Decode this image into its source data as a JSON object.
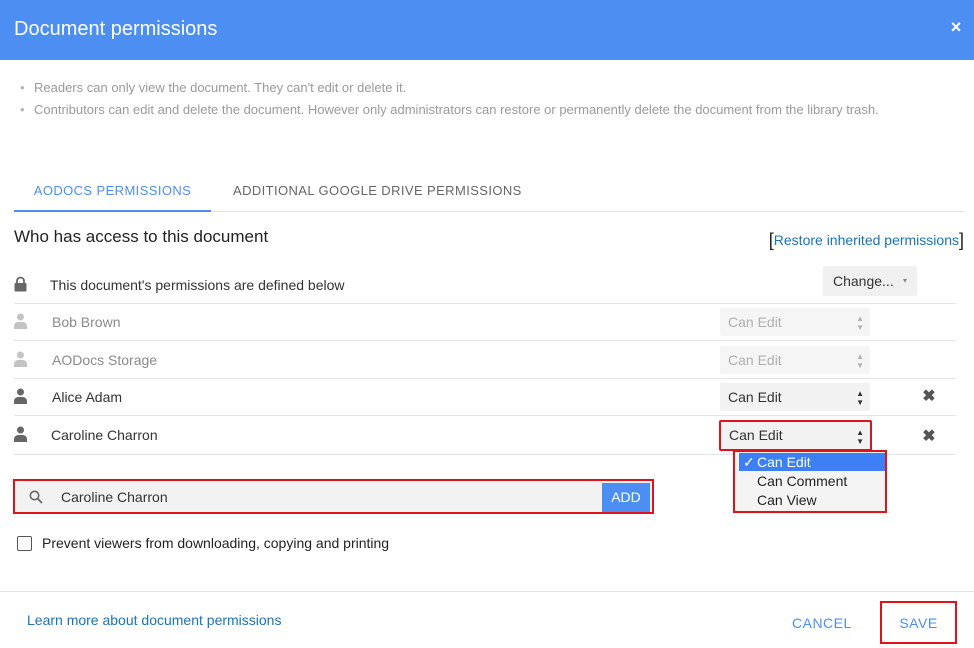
{
  "header": {
    "title": "Document permissions",
    "close_label": "×"
  },
  "info": [
    "Readers can only view the document. They can't edit or delete it.",
    "Contributors can edit and delete the document. However only administrators can restore or permanently delete the document from the library trash."
  ],
  "tabs": [
    {
      "label": "AODOCS PERMISSIONS",
      "active": true
    },
    {
      "label": "ADDITIONAL GOOGLE DRIVE PERMISSIONS",
      "active": false
    }
  ],
  "access": {
    "heading": "Who has access to this document",
    "restore_open": "[",
    "restore_label": "Restore inherited permissions",
    "restore_close": "]",
    "defined_text": "This document's permissions are defined below",
    "change_label": "Change...",
    "change_caret": "▾"
  },
  "users": [
    {
      "name": "Bob Brown",
      "permission": "Can Edit",
      "disabled": true
    },
    {
      "name": "AODocs Storage",
      "permission": "Can Edit",
      "disabled": true
    },
    {
      "name": "Alice Adam",
      "permission": "Can Edit",
      "disabled": false,
      "remove_label": "✖"
    },
    {
      "name": "Caroline Charron",
      "permission": "Can Edit",
      "disabled": false,
      "remove_label": "✖"
    }
  ],
  "select_arrows": "▲\n▼",
  "dropdown": {
    "check": "✓",
    "options": [
      "Can Edit",
      "Can Comment",
      "Can View"
    ],
    "selected": "Can Edit"
  },
  "search": {
    "value": "Caroline Charron",
    "add_label": "ADD"
  },
  "prevent": {
    "label": "Prevent viewers from downloading, copying and printing",
    "checked": false
  },
  "footer": {
    "learn_more": "Learn more about document permissions",
    "cancel_label": "CANCEL",
    "save_label": "SAVE"
  },
  "colors": {
    "accent": "#4c8ef2",
    "highlight": "#e0121a",
    "link": "#1a73b8"
  },
  "icons": [
    "close-icon",
    "lock-icon",
    "person-icon",
    "search-icon",
    "sort-arrows-icon",
    "remove-icon",
    "checkmark-icon"
  ]
}
